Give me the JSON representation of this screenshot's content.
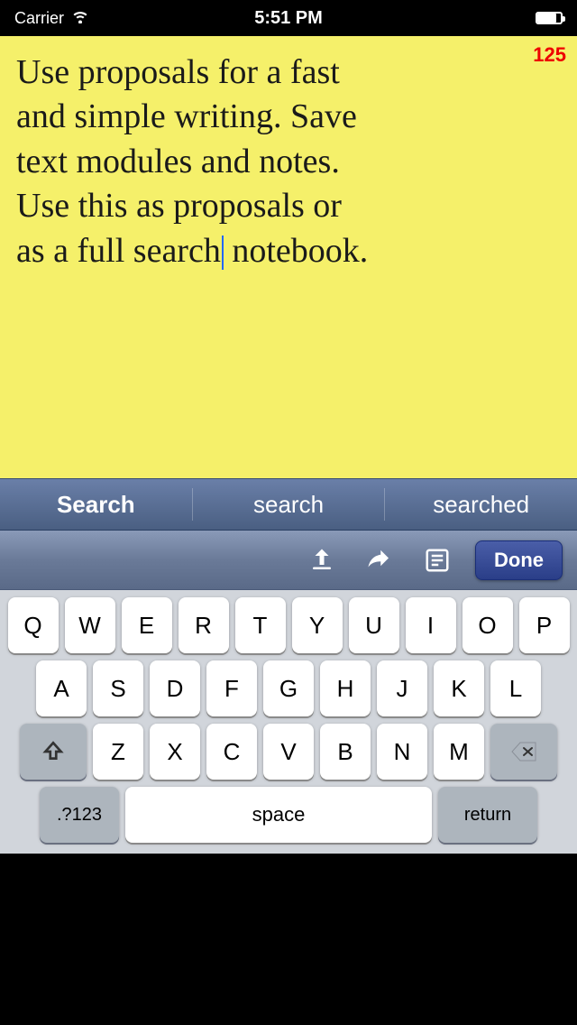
{
  "statusBar": {
    "carrier": "Carrier",
    "time": "5:51 PM"
  },
  "noteArea": {
    "text_line1": "Use proposals for a fast",
    "text_line2": "and simple writing. Save",
    "text_line3": "text modules and notes.",
    "text_line4": "Use this as proposals or",
    "text_line5": "as a full search",
    "text_line5b": " notebook.",
    "badge": "125"
  },
  "autocomplete": {
    "item1": "Search",
    "item2": "search",
    "item3": "searched"
  },
  "toolbar": {
    "done_label": "Done"
  },
  "keyboard": {
    "row1": [
      "Q",
      "W",
      "E",
      "R",
      "T",
      "Y",
      "U",
      "I",
      "O",
      "P"
    ],
    "row2": [
      "A",
      "S",
      "D",
      "F",
      "G",
      "H",
      "J",
      "K",
      "L"
    ],
    "row3": [
      "Z",
      "X",
      "C",
      "V",
      "B",
      "N",
      "M"
    ],
    "numbers_label": ".?123",
    "space_label": "space",
    "return_label": "return"
  }
}
